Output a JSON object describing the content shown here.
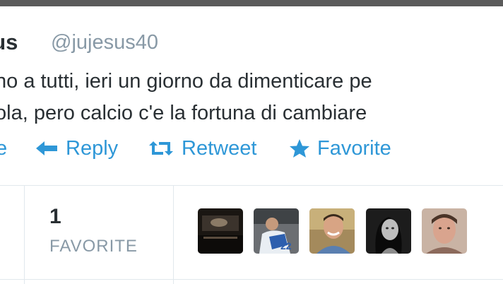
{
  "tweet": {
    "author_name": "sus",
    "author_handle": "@jujesus40",
    "text_lines": [
      "no a tutti, ieri un giorno da dimenticare pe",
      "ola, pero calcio c'e la fortuna di cambiare"
    ],
    "link_color": "#2e97d7"
  },
  "actions": [
    {
      "label": "e",
      "icon": "fragment-icon"
    },
    {
      "label": "Reply",
      "icon": "reply-arrow-icon"
    },
    {
      "label": "Retweet",
      "icon": "retweet-icon"
    },
    {
      "label": "Favorite",
      "icon": "star-icon"
    }
  ],
  "stats": {
    "favorites_count": "1",
    "favorites_label": "FAVORITE"
  },
  "avatars": [
    {
      "icon": "avatar-dark-photo"
    },
    {
      "icon": "avatar-jersey-22"
    },
    {
      "icon": "avatar-smiling-man"
    },
    {
      "icon": "avatar-bw-woman"
    },
    {
      "icon": "avatar-young-man"
    }
  ]
}
